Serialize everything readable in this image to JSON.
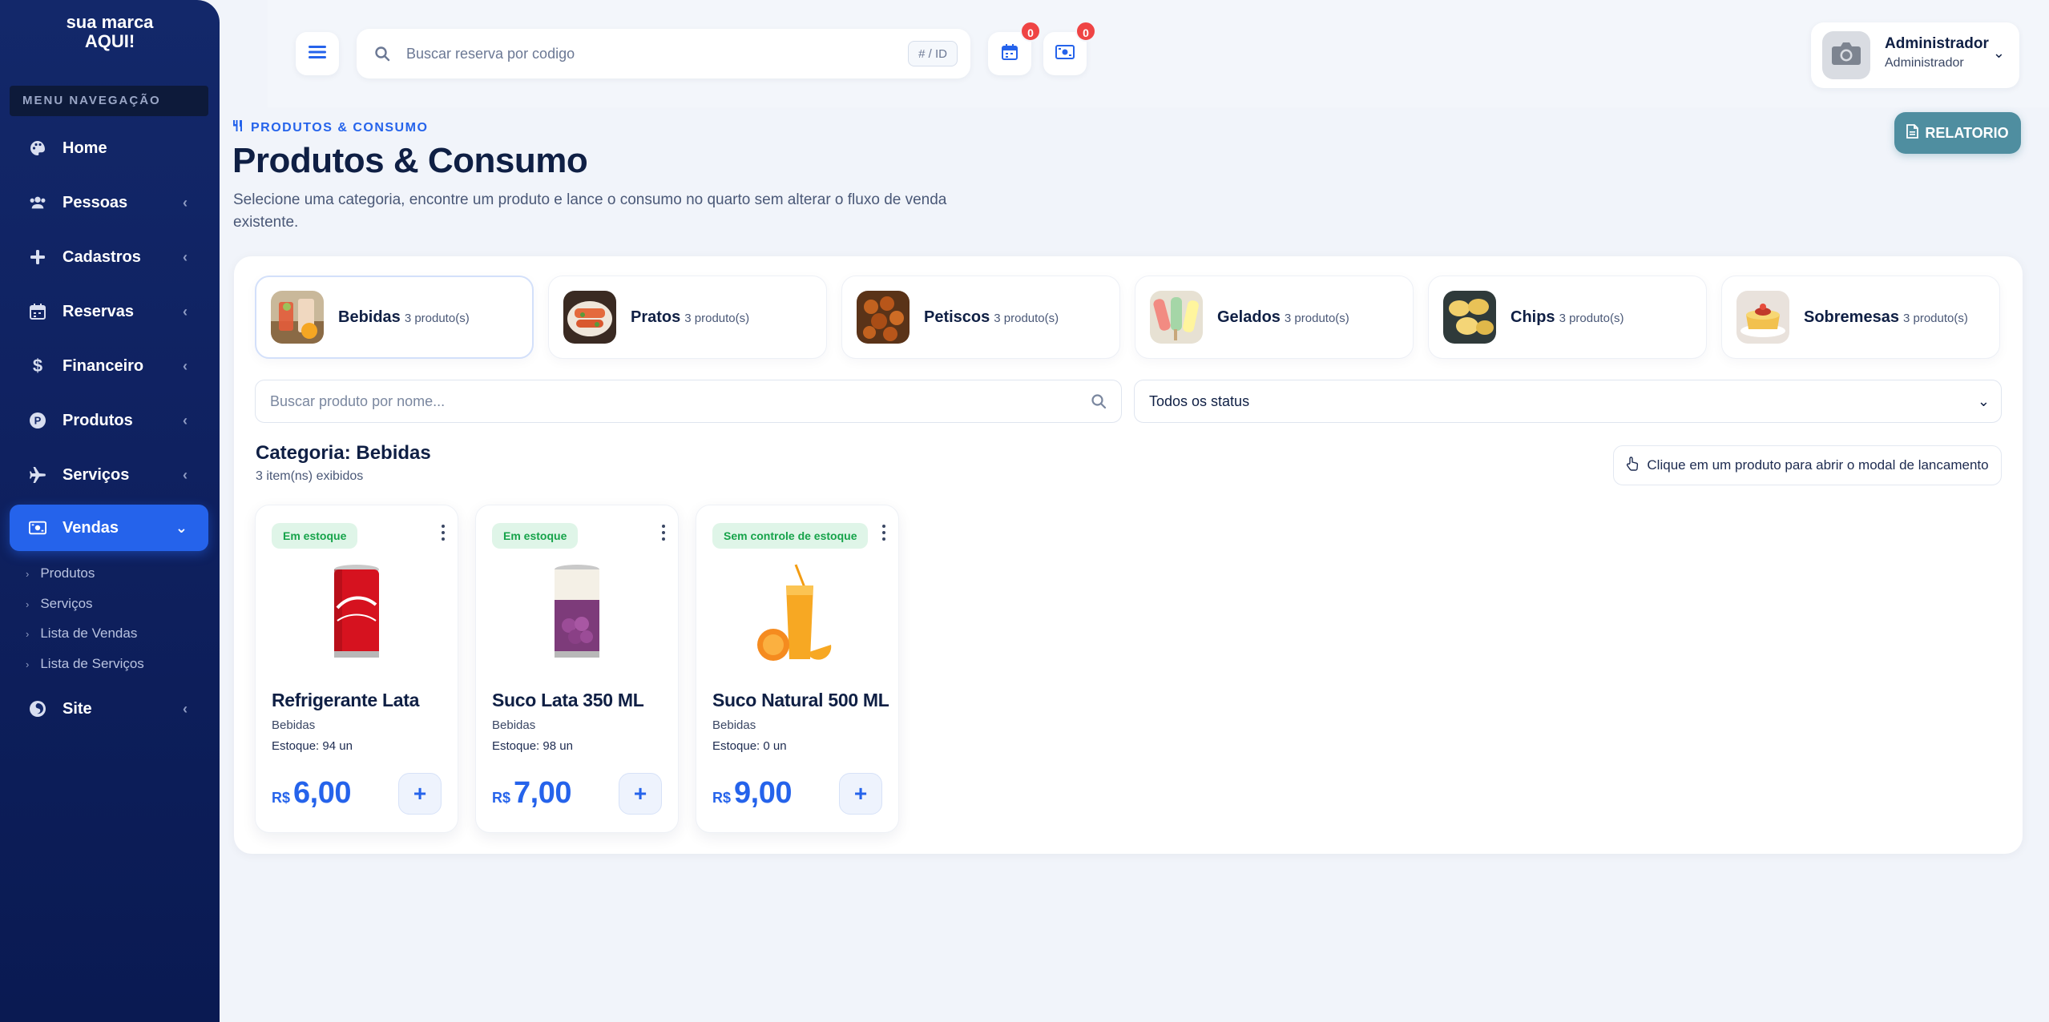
{
  "sidebar": {
    "brand": "sua marca AQUI!",
    "menu_caption": "MENU NAVEGAÇÃO",
    "items": [
      {
        "label": "Home",
        "icon": "palette-icon"
      },
      {
        "label": "Pessoas",
        "icon": "users-icon"
      },
      {
        "label": "Cadastros",
        "icon": "plus-icon"
      },
      {
        "label": "Reservas",
        "icon": "calendar-icon"
      },
      {
        "label": "Financeiro",
        "icon": "dollar-icon"
      },
      {
        "label": "Produtos",
        "icon": "product-p-icon"
      },
      {
        "label": "Serviços",
        "icon": "plane-icon"
      },
      {
        "label": "Vendas",
        "icon": "money-icon"
      },
      {
        "label": "Site",
        "icon": "firefox-icon"
      }
    ],
    "vendas_sub": [
      "Produtos",
      "Serviços",
      "Lista de Vendas",
      "Lista de Serviços"
    ]
  },
  "topbar": {
    "search_placeholder": "Buscar reserva por codigo",
    "search_kbd": "# / ID",
    "calendar_badge": "0",
    "money_badge": "0",
    "user_name": "Administrador",
    "user_role": "Administrador"
  },
  "header": {
    "breadcrumb": "PRODUTOS & CONSUMO",
    "title": "Produtos & Consumo",
    "description": "Selecione uma categoria, encontre um produto e lance o consumo no quarto sem alterar o fluxo de venda existente.",
    "report_button": "RELATORIO"
  },
  "categories": [
    {
      "name": "Bebidas",
      "count": "3 produto(s)"
    },
    {
      "name": "Pratos",
      "count": "3 produto(s)"
    },
    {
      "name": "Petiscos",
      "count": "3 produto(s)"
    },
    {
      "name": "Gelados",
      "count": "3 produto(s)"
    },
    {
      "name": "Chips",
      "count": "3 produto(s)"
    },
    {
      "name": "Sobremesas",
      "count": "3 produto(s)"
    }
  ],
  "filters": {
    "product_search_placeholder": "Buscar produto por nome...",
    "status_selected": "Todos os status"
  },
  "listing": {
    "heading": "Categoria: Bebidas",
    "count": "3 item(ns) exibidos",
    "hint": "Clique em um produto para abrir o modal de lancamento"
  },
  "products": [
    {
      "status": "Em estoque",
      "name": "Refrigerante Lata",
      "category": "Bebidas",
      "stock": "Estoque: 94 un",
      "currency": "R$",
      "price": "6,00"
    },
    {
      "status": "Em estoque",
      "name": "Suco Lata 350 ML",
      "category": "Bebidas",
      "stock": "Estoque: 98 un",
      "currency": "R$",
      "price": "7,00"
    },
    {
      "status": "Sem controle de estoque",
      "name": "Suco Natural 500 ML",
      "category": "Bebidas",
      "stock": "Estoque: 0 un",
      "currency": "R$",
      "price": "9,00"
    }
  ],
  "colors": {
    "accent": "#2563eb",
    "sidebar": "#0f2160",
    "report": "#4f8ea0",
    "success_bg": "#dff5e8",
    "success": "#16a34a",
    "badge": "#ef4444"
  }
}
